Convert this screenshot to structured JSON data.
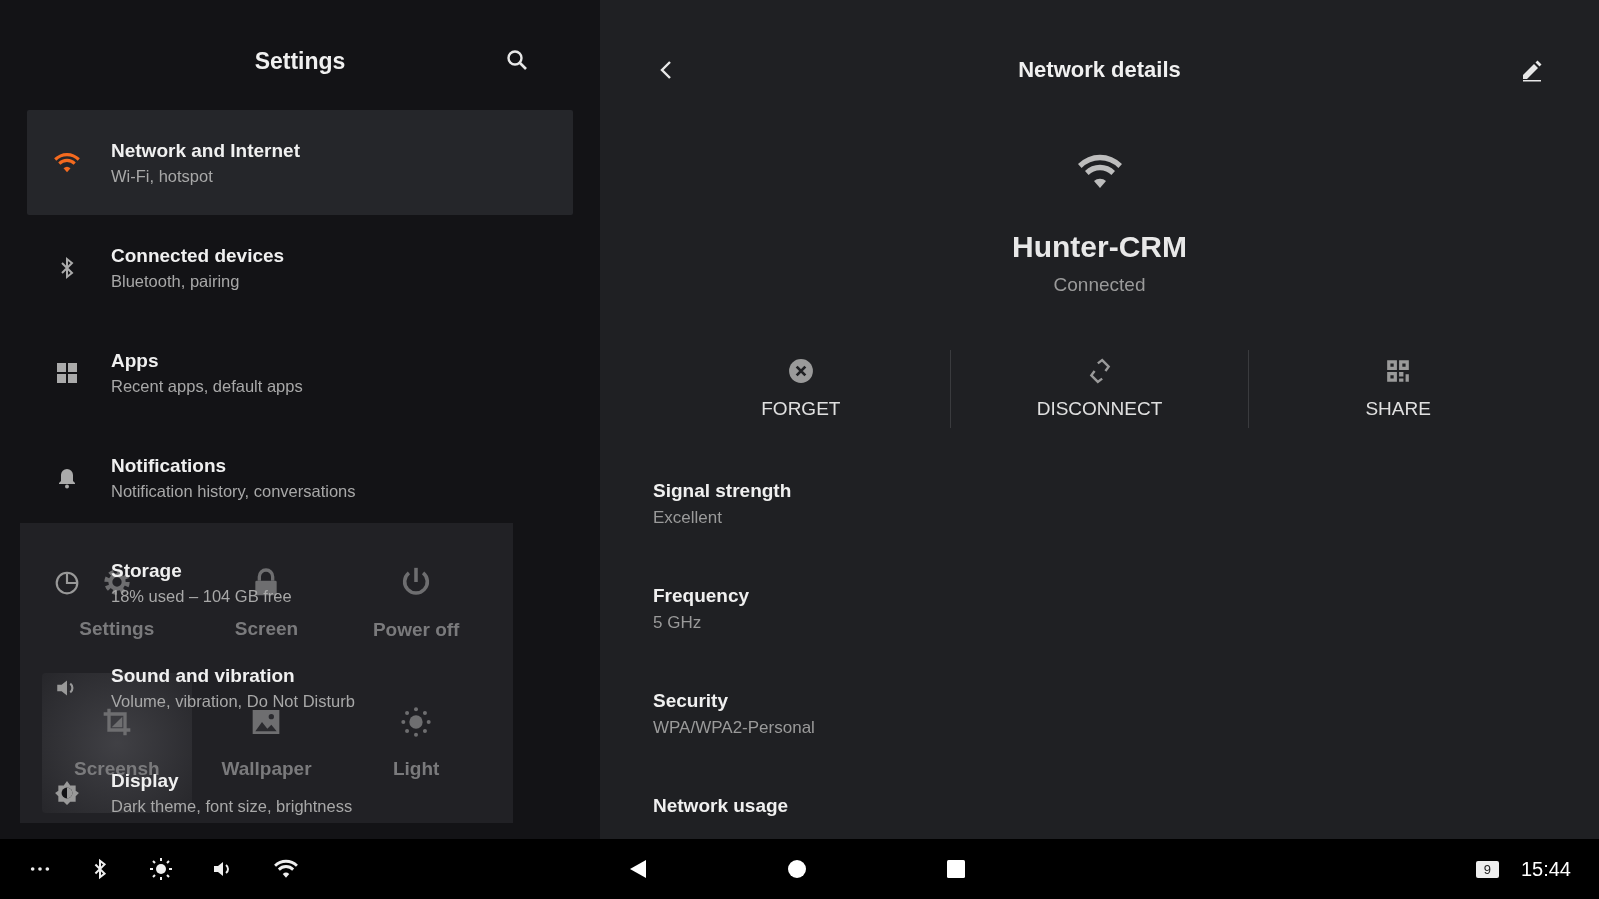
{
  "settings": {
    "title": "Settings",
    "items": [
      {
        "kind": "wifi",
        "title": "Network and Internet",
        "subtitle": "Wi-Fi, hotspot",
        "selected": true
      },
      {
        "kind": "bluetooth",
        "title": "Connected devices",
        "subtitle": "Bluetooth, pairing",
        "selected": false
      },
      {
        "kind": "apps",
        "title": "Apps",
        "subtitle": "Recent apps, default apps",
        "selected": false
      },
      {
        "kind": "bell",
        "title": "Notifications",
        "subtitle": "Notification history, conversations",
        "selected": false
      },
      {
        "kind": "storage",
        "title": "Storage",
        "subtitle": "18% used – 104 GB free",
        "selected": false
      },
      {
        "kind": "sound",
        "title": "Sound and vibration",
        "subtitle": "Volume, vibration, Do Not Disturb",
        "selected": false
      },
      {
        "kind": "display",
        "title": "Display",
        "subtitle": "Dark theme, font size, brightness",
        "selected": false
      }
    ]
  },
  "quick_panel": {
    "tiles": [
      {
        "kind": "gear",
        "label": "Settings",
        "highlighted": false
      },
      {
        "kind": "lock",
        "label": "Screen",
        "highlighted": false
      },
      {
        "kind": "power",
        "label": "Power off",
        "highlighted": false
      },
      {
        "kind": "crop",
        "label": "Screensh",
        "highlighted": true
      },
      {
        "kind": "image",
        "label": "Wallpaper",
        "highlighted": false
      },
      {
        "kind": "sun",
        "label": "Light",
        "highlighted": false
      }
    ]
  },
  "network_details": {
    "title": "Network details",
    "network_name": "Hunter-CRM",
    "status": "Connected",
    "actions": [
      {
        "kind": "forget",
        "label": "FORGET"
      },
      {
        "kind": "disconnect",
        "label": "DISCONNECT"
      },
      {
        "kind": "share",
        "label": "SHARE"
      }
    ],
    "details": [
      {
        "label": "Signal strength",
        "value": "Excellent"
      },
      {
        "label": "Frequency",
        "value": "5 GHz"
      },
      {
        "label": "Security",
        "value": "WPA/WPA2-Personal"
      },
      {
        "label": "Network usage"
      }
    ]
  },
  "navigation_bar": {
    "notification_count": "9",
    "time": "15:44"
  }
}
